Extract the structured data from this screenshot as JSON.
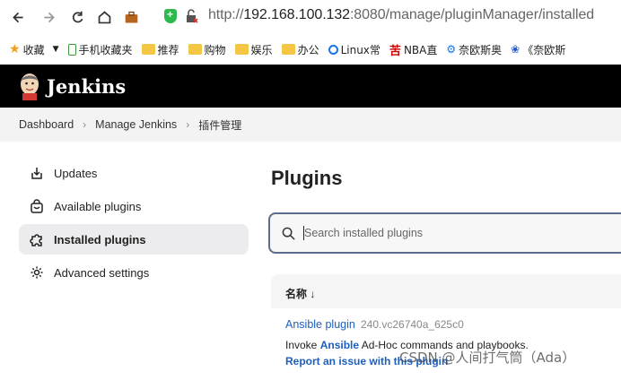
{
  "browser": {
    "url_scheme": "http://",
    "url_host": "192.168.100.132",
    "url_rest": ":8080/manage/pluginManager/installed"
  },
  "bookmarks": [
    {
      "label": "收藏",
      "icon": "star-icon"
    },
    {
      "label": "手机收藏夹",
      "icon": "phone-icon"
    },
    {
      "label": "推荐",
      "icon": "folder-icon"
    },
    {
      "label": "购物",
      "icon": "folder-icon"
    },
    {
      "label": "娱乐",
      "icon": "folder-icon"
    },
    {
      "label": "办公",
      "icon": "folder-icon"
    },
    {
      "label": "Linux常",
      "icon": "search-icon"
    },
    {
      "label": "NBA直",
      "icon": "hupu-icon"
    },
    {
      "label": "奈欧斯奥",
      "icon": "link-icon"
    },
    {
      "label": "《奈欧斯",
      "icon": "paw-icon"
    }
  ],
  "header": {
    "title": "Jenkins"
  },
  "breadcrumb": {
    "items": [
      "Dashboard",
      "Manage Jenkins",
      "插件管理"
    ]
  },
  "sidebar": {
    "items": [
      {
        "label": "Updates",
        "icon": "download-icon"
      },
      {
        "label": "Available plugins",
        "icon": "shopping-bag-icon"
      },
      {
        "label": "Installed plugins",
        "icon": "puzzle-icon"
      },
      {
        "label": "Advanced settings",
        "icon": "gear-icon"
      }
    ]
  },
  "main": {
    "title": "Plugins",
    "search_placeholder": "Search installed plugins",
    "table": {
      "column_name": "名称 ↓",
      "rows": [
        {
          "name": "Ansible plugin",
          "version": "240.vc26740a_625c0",
          "desc_prefix": "Invoke ",
          "desc_bold": "Ansible",
          "desc_suffix": " Ad-Hoc commands and playbooks.",
          "issue_link": "Report an issue with this plugin"
        }
      ]
    }
  },
  "watermark": "CSDN @人间打气筒（Ada）"
}
